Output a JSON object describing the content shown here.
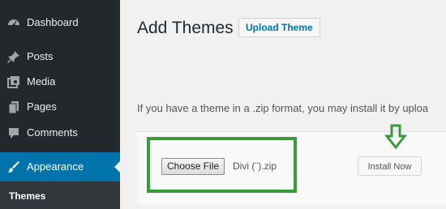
{
  "sidebar": {
    "items": [
      {
        "label": "Dashboard",
        "icon": "dashboard-icon"
      },
      {
        "label": "Posts",
        "icon": "pin-icon"
      },
      {
        "label": "Media",
        "icon": "media-icon"
      },
      {
        "label": "Pages",
        "icon": "pages-icon"
      },
      {
        "label": "Comments",
        "icon": "comments-icon"
      },
      {
        "label": "Appearance",
        "icon": "appearance-brush-icon",
        "active": true
      }
    ],
    "submenu": {
      "label": "Themes"
    }
  },
  "main": {
    "title": "Add Themes",
    "upload_button": "Upload Theme",
    "description": "If you have a theme in a .zip format, you may install it by uploa",
    "file_input": {
      "button_label": "Choose File",
      "file_name": "Divi (¨).zip"
    },
    "install_button": "Install Now"
  },
  "colors": {
    "sidebar_bg": "#23282d",
    "active_bg": "#0073aa",
    "highlight_green": "#3a9b3d",
    "page_bg": "#f1f1f1"
  }
}
